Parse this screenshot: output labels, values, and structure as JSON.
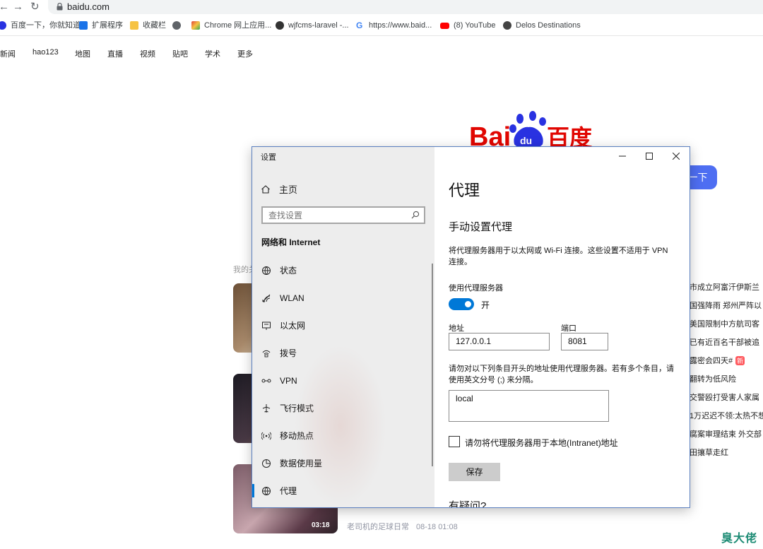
{
  "browser": {
    "url": "baidu.com",
    "bookmarks": [
      {
        "label": "百度一下，你就知道",
        "icon": "baidu-paw-icon",
        "color": "#2932e1"
      },
      {
        "label": "扩展程序",
        "icon": "puzzle-icon",
        "color": "#1a73e8"
      },
      {
        "label": "收藏栏",
        "icon": "folder-icon",
        "color": "#f6c344"
      },
      {
        "label": "",
        "icon": "globe-icon",
        "color": "#5f6368"
      },
      {
        "label": "Chrome 网上应用...",
        "icon": "chrome-store-icon",
        "color": "#e0453a"
      },
      {
        "label": "wjfcms-laravel -...",
        "icon": "github-avatar-icon",
        "color": "#333333"
      },
      {
        "label": "https://www.baid...",
        "icon": "google-icon",
        "color": "#4285f4"
      },
      {
        "label": "(8) YouTube",
        "icon": "youtube-icon",
        "color": "#ff0000"
      },
      {
        "label": "Delos Destinations",
        "icon": "delos-icon",
        "color": "#444444"
      }
    ]
  },
  "baidu": {
    "nav": [
      "新闻",
      "hao123",
      "地图",
      "直播",
      "视频",
      "贴吧",
      "学术",
      "更多"
    ],
    "logo_text": "Bai百度",
    "logo_du": "du",
    "search_button": "一下",
    "my_follow": "我的关",
    "video_time": "03:18",
    "video_source": "老司机的足球日常",
    "video_date": "08-18 01:08",
    "hotlist": [
      "市成立阿富汗伊斯兰",
      "国强降雨 郑州严阵以",
      "美国限制中方航司客",
      "已有近百名干部被追",
      "露密会四天#",
      "翻转为低风险",
      "交警殴打受害人家属",
      "1万迟迟不领:太热不想",
      "腐案审理结束 外交部",
      "田攘草走红"
    ],
    "hot_badge": "新",
    "watermark": "臭大佬"
  },
  "settings": {
    "title": "设置",
    "home": "主页",
    "search_placeholder": "查找设置",
    "section": "网络和 Internet",
    "nav": [
      {
        "label": "状态",
        "icon": "globe-status-icon"
      },
      {
        "label": "WLAN",
        "icon": "wifi-icon"
      },
      {
        "label": "以太网",
        "icon": "ethernet-icon"
      },
      {
        "label": "拨号",
        "icon": "dialup-icon"
      },
      {
        "label": "VPN",
        "icon": "vpn-icon"
      },
      {
        "label": "飞行模式",
        "icon": "airplane-icon"
      },
      {
        "label": "移动热点",
        "icon": "hotspot-icon"
      },
      {
        "label": "数据使用量",
        "icon": "data-usage-icon"
      },
      {
        "label": "代理",
        "icon": "proxy-globe-icon"
      }
    ],
    "active_nav": "代理",
    "content": {
      "page_title": "代理",
      "sub_title": "手动设置代理",
      "description": "将代理服务器用于以太网或 Wi-Fi 连接。这些设置不适用于 VPN 连接。",
      "use_proxy_label": "使用代理服务器",
      "toggle_state": "开",
      "address_label": "地址",
      "address_value": "127.0.0.1",
      "port_label": "端口",
      "port_value": "8081",
      "exceptions_desc": "请勿对以下列条目开头的地址使用代理服务器。若有多个条目，请使用英文分号 (;) 来分隔。",
      "exceptions_value": "local",
      "bypass_local_label": "请勿将代理服务器用于本地(Intranet)地址",
      "save_button": "保存",
      "question": "有疑问?"
    }
  }
}
